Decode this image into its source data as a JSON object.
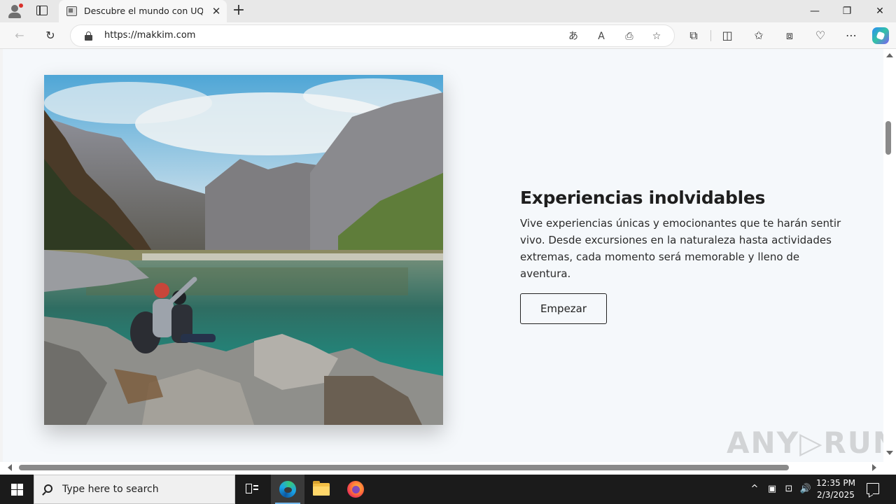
{
  "browser": {
    "tab": {
      "title": "Descubre el mundo con UQAKBI",
      "close_label": "✕"
    },
    "new_tab_label": "+",
    "window_controls": {
      "minimize": "—",
      "restore": "❐",
      "close": "✕"
    },
    "address": {
      "url": "https://makkim.com"
    },
    "toolbar_icons": {
      "back": "←",
      "refresh": "↻",
      "translate": "あ",
      "read_aloud": "A",
      "immersive_reader": "⎙",
      "favorite": "☆",
      "extensions": "⧉",
      "split_screen": "◫",
      "favorites": "✩",
      "collections": "⧈",
      "performance": "♡",
      "more": "⋯"
    }
  },
  "page": {
    "heading": "Experiencias inolvidables",
    "description": "Vive experiencias únicas y emocionantes que te harán sentir vivo. Desde excursiones en la naturaleza hasta actividades extremas, cada momento será memorable y lleno de aventura.",
    "cta_label": "Empezar"
  },
  "watermark": "ANY▷RUN",
  "taskbar": {
    "search_placeholder": "Type here to search",
    "clock": {
      "time": "12:35 PM",
      "date": "2/3/2025"
    },
    "tray": {
      "chevron": "^",
      "network": "⊡",
      "volume": "🔊"
    }
  }
}
